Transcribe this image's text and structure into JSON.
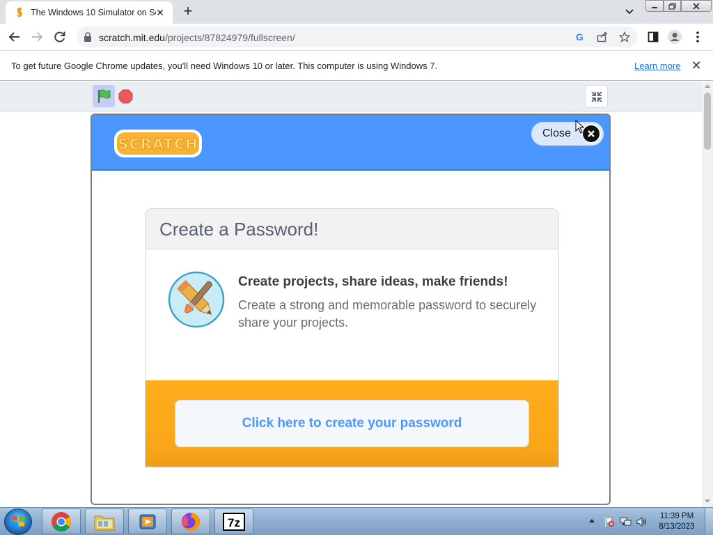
{
  "browser": {
    "tab": {
      "title": "The Windows 10 Simulator on Scratch",
      "favicon": "scratch-favicon"
    },
    "url": {
      "host": "scratch.mit.edu",
      "path": "/projects/87824979/fullscreen/"
    },
    "infobar": {
      "message": "To get future Google Chrome updates, you'll need Windows 10 or later. This computer is using Windows 7.",
      "link": "Learn more"
    }
  },
  "scratch": {
    "close_label": "Close",
    "logo_text": "SCRATCH",
    "card": {
      "title": "Create a Password!",
      "heading": "Create projects, share ideas, make friends!",
      "description": "Create a strong and memorable password to securely share your projects.",
      "cta": "Click here to create your password"
    },
    "colors": {
      "header": "#4c97ff",
      "cta_band": "#ffab19",
      "cta_text": "#4c97ff"
    }
  },
  "taskbar": {
    "apps": [
      "chrome",
      "file-explorer",
      "media-player",
      "firefox",
      "7-zip"
    ],
    "app_7z_label": "7z",
    "clock": {
      "time": "11:39 PM",
      "date": "8/13/2023"
    }
  }
}
